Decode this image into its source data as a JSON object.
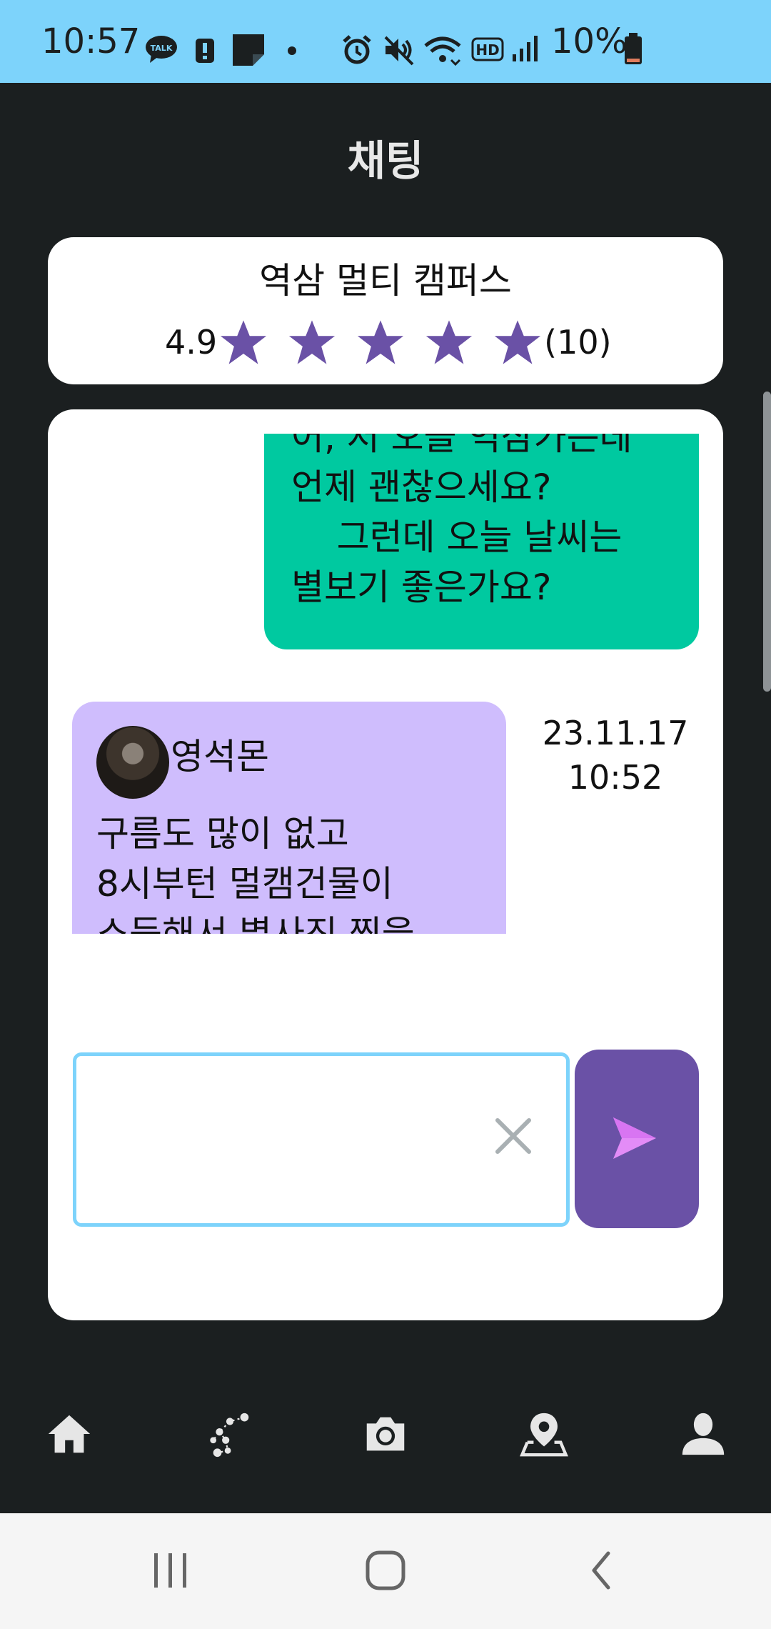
{
  "status_bar": {
    "time": "10:57",
    "battery_percent": "10%",
    "icons": [
      "kakaotalk-icon",
      "alert-icon",
      "note-icon",
      "dot-icon",
      "alarm-icon",
      "mute-icon",
      "wifi-icon",
      "hd-icon",
      "signal-icon",
      "battery-icon"
    ]
  },
  "header": {
    "title": "채팅"
  },
  "place": {
    "name": "역삼 멀티 캠퍼스",
    "rating": "4.9",
    "review_count": "(10)",
    "stars": 5
  },
  "chat": {
    "messages": [
      {
        "side": "mine",
        "text": "어, 저 오늘 역삼가는데\n언제 괜찮으세요?\n    그런데 오늘 날씨는\n별보기 좋은가요?"
      },
      {
        "side": "other",
        "sender": "영석몬",
        "text": "구름도 많이 없고\n8시부턴 멀캠건물이\n소등해서 별사진 찍을",
        "timestamp_date": "23.11.17",
        "timestamp_time": "10:52"
      }
    ]
  },
  "input": {
    "value": "",
    "placeholder": ""
  },
  "bottom_nav": {
    "items": [
      "home-icon",
      "constellation-icon",
      "camera-icon",
      "map-pin-icon",
      "profile-icon"
    ]
  },
  "colors": {
    "status_bar": "#7dd3fb",
    "background": "#1b1f20",
    "my_bubble": "#00c9a0",
    "other_bubble": "#cfbdfd",
    "accent": "#6a51a6",
    "star": "#6a51a6"
  }
}
